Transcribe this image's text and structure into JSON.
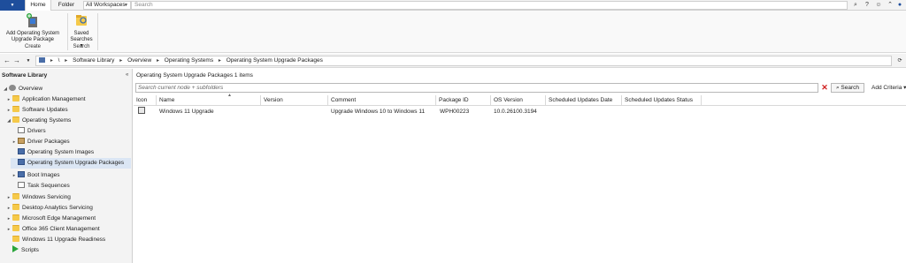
{
  "topbar": {
    "app_menu": "▼",
    "tabs": [
      {
        "label": "Home"
      },
      {
        "label": "Folder"
      }
    ],
    "workspace_label": "All Workspaces",
    "search_placeholder": "Search"
  },
  "ribbon": {
    "buttons": [
      {
        "label_line1": "Add Operating System",
        "label_line2": "Upgrade Package",
        "icon": "add-upgrade-package-icon"
      },
      {
        "label_line1": "Saved",
        "label_line2": "Searches ▾",
        "icon": "saved-searches-icon"
      }
    ],
    "groups": [
      {
        "label": "Create"
      },
      {
        "label": "Search"
      }
    ]
  },
  "navbar": {
    "breadcrumb": [
      "\\",
      "Software Library",
      "Overview",
      "Operating Systems",
      "Operating System Upgrade Packages"
    ]
  },
  "left_panel": {
    "title": "Software Library",
    "items": [
      {
        "label": "Overview"
      },
      {
        "label": "Application Management"
      },
      {
        "label": "Software Updates"
      },
      {
        "label": "Operating Systems"
      },
      {
        "label": "Drivers"
      },
      {
        "label": "Driver Packages"
      },
      {
        "label": "Operating System Images"
      },
      {
        "label": "Operating System Upgrade Packages"
      },
      {
        "label": "Boot Images"
      },
      {
        "label": "Task Sequences"
      },
      {
        "label": "Windows Servicing"
      },
      {
        "label": "Desktop Analytics Servicing"
      },
      {
        "label": "Microsoft Edge Management"
      },
      {
        "label": "Office 365 Client Management"
      },
      {
        "label": "Windows 11 Upgrade Readiness"
      },
      {
        "label": "Scripts"
      }
    ]
  },
  "content": {
    "title": "Operating System Upgrade Packages 1 items",
    "search_placeholder": "Search current node + subfolders",
    "search_button": "Search",
    "add_criteria": "Add Criteria ▾",
    "columns": [
      "Icon",
      "Name",
      "Version",
      "Comment",
      "Package ID",
      "OS Version",
      "Scheduled Updates Date",
      "Scheduled Updates Status"
    ],
    "rows": [
      {
        "name": "Windows 11 Upgrade",
        "version": "",
        "comment": "Upgrade Windows 10 to Windows 11",
        "package_id": "WPH00223",
        "os_version": "10.0.26100.3194",
        "sched_date": "",
        "sched_status": ""
      }
    ]
  }
}
